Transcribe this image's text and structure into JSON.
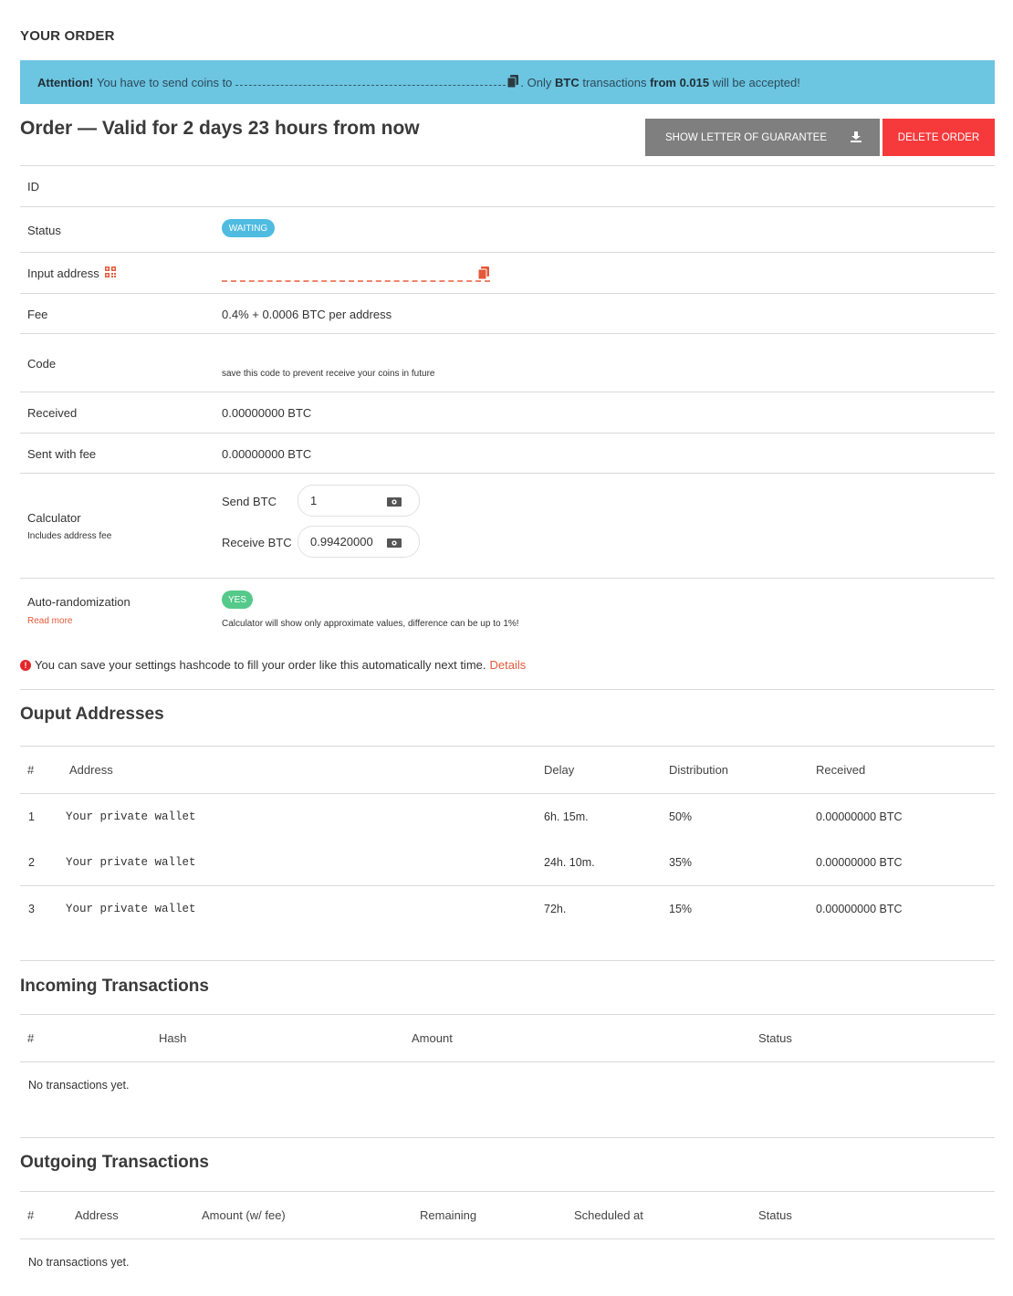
{
  "page": {
    "heading": "YOUR ORDER"
  },
  "alert": {
    "attention": "Attention!",
    "text_before": "You have to send coins to",
    "text_only": ". Only",
    "coin": "BTC",
    "text_transactions": "transactions",
    "from": "from 0.015",
    "text_after": "will be accepted!"
  },
  "order": {
    "title": "Order — Valid for 2 days 23 hours from now",
    "guarantee_button": "SHOW LETTER OF GUARANTEE",
    "delete_button": "DELETE ORDER"
  },
  "details": {
    "id_label": "ID",
    "status_label": "Status",
    "status_value": "WAITING",
    "input_address_label": "Input address",
    "fee_label": "Fee",
    "fee_value": "0.4% + 0.0006 BTC per address",
    "code_label": "Code",
    "code_hint": "save this code to prevent receive your coins in future",
    "received_label": "Received",
    "received_value": "0.00000000 BTC",
    "sent_label": "Sent with fee",
    "sent_value": "0.00000000 BTC",
    "calculator_label": "Calculator",
    "calculator_sub": "Includes address fee",
    "send_label": "Send BTC",
    "send_value": "1",
    "receive_label": "Receive BTC",
    "receive_value": "0.99420000",
    "autorand_label": "Auto-randomization",
    "autorand_value": "YES",
    "read_more": "Read more",
    "approx_note": "Calculator will show only approximate values, difference can be up to 1%!"
  },
  "notice": {
    "text": "You can save your settings hashcode to fill your order like this automatically next time.",
    "link": "Details"
  },
  "outputs": {
    "title": "Ouput Addresses",
    "headers": [
      "#",
      "Address",
      "Delay",
      "Distribution",
      "Received"
    ],
    "rows": [
      {
        "n": "1",
        "address": "Your private wallet",
        "delay": "6h. 15m.",
        "distribution": "50%",
        "received": "0.00000000 BTC"
      },
      {
        "n": "2",
        "address": "Your private wallet",
        "delay": "24h. 10m.",
        "distribution": "35%",
        "received": "0.00000000 BTC"
      },
      {
        "n": "3",
        "address": "Your private wallet",
        "delay": "72h.",
        "distribution": "15%",
        "received": "0.00000000 BTC"
      }
    ]
  },
  "incoming": {
    "title": "Incoming Transactions",
    "headers": [
      "#",
      "Hash",
      "Amount",
      "Status"
    ],
    "empty": "No transactions yet."
  },
  "outgoing": {
    "title": "Outgoing Transactions",
    "headers": [
      "#",
      "Address",
      "Amount (w/ fee)",
      "Remaining",
      "Scheduled at",
      "Status"
    ],
    "empty": "No transactions yet."
  },
  "colors": {
    "alert_bg": "#6cc5e1",
    "guarantee_bg": "#7f7f7f",
    "delete_bg": "#f63a3c",
    "waiting_badge": "#4fbbe0",
    "yes_badge": "#55c98a",
    "accent_link": "#e4593a"
  },
  "icons": [
    "copy-icon",
    "download-icon",
    "qr-code-icon",
    "cash-icon",
    "warning-icon"
  ]
}
